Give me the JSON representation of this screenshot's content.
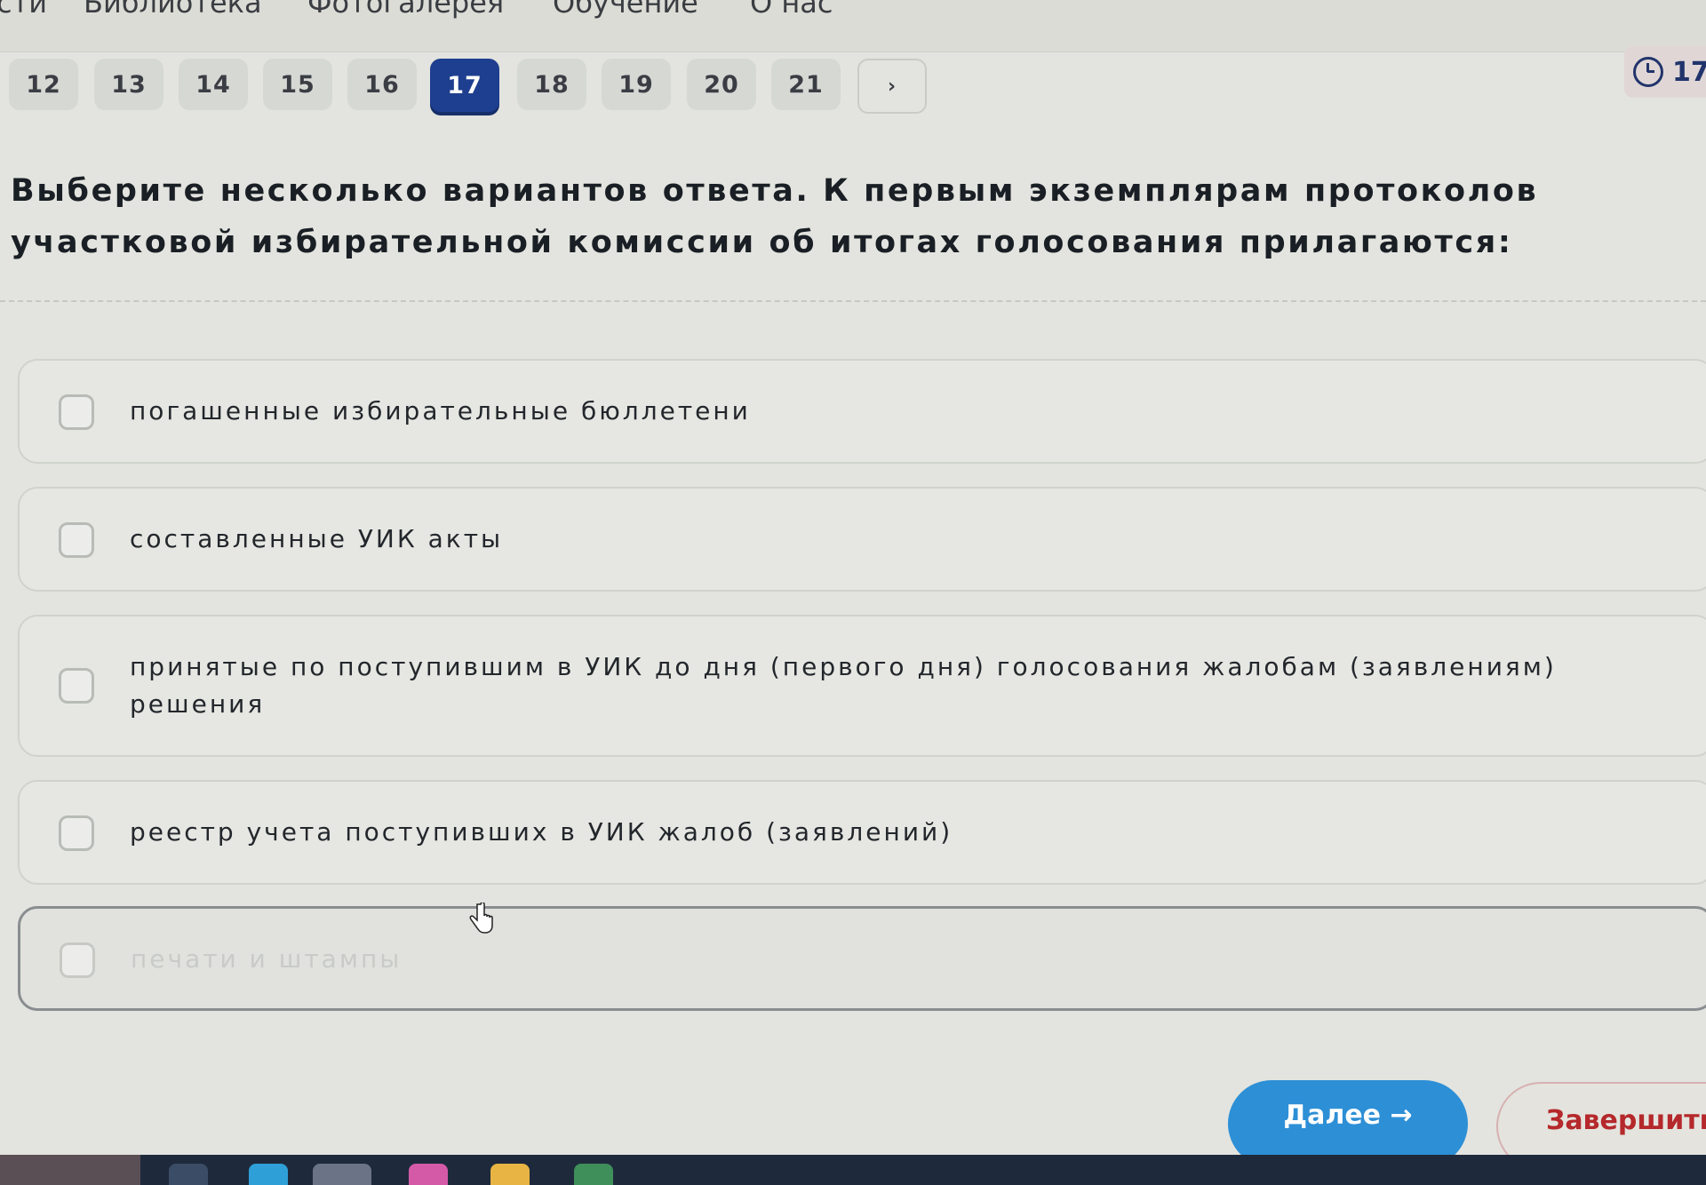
{
  "topnav": {
    "items": [
      "сти",
      "Библиотека",
      "Фотогалерея",
      "Обучение",
      "О нас"
    ]
  },
  "pagination": {
    "pages": [
      "12",
      "13",
      "14",
      "15",
      "16",
      "17",
      "18",
      "19",
      "20",
      "21"
    ],
    "current": "17",
    "next_label": "›"
  },
  "timer": {
    "text": "17"
  },
  "question": {
    "text": "Выберите несколько вариантов ответа. К первым экземплярам протоколов участковой избирательной комиссии об итогах голосования прилагаются:"
  },
  "options": [
    {
      "label": "погашенные избирательные бюллетени",
      "checked": false
    },
    {
      "label": "составленные УИК акты",
      "checked": false
    },
    {
      "label": "принятые по поступившим в УИК до дня (первого дня) голосования жалобам (заявлениям) решения",
      "checked": false
    },
    {
      "label": "реестр учета поступивших в УИК жалоб (заявлений)",
      "checked": false
    },
    {
      "label": "печати и штампы",
      "checked": false
    }
  ],
  "buttons": {
    "next": "Далее →",
    "finish": "Завершить"
  },
  "colors": {
    "accent": "#1e3f8f",
    "next_button": "#2d8fd6",
    "finish_text": "#b5282b"
  },
  "icons": {
    "timer": "clock-icon",
    "cursor": "hand-cursor-icon"
  }
}
